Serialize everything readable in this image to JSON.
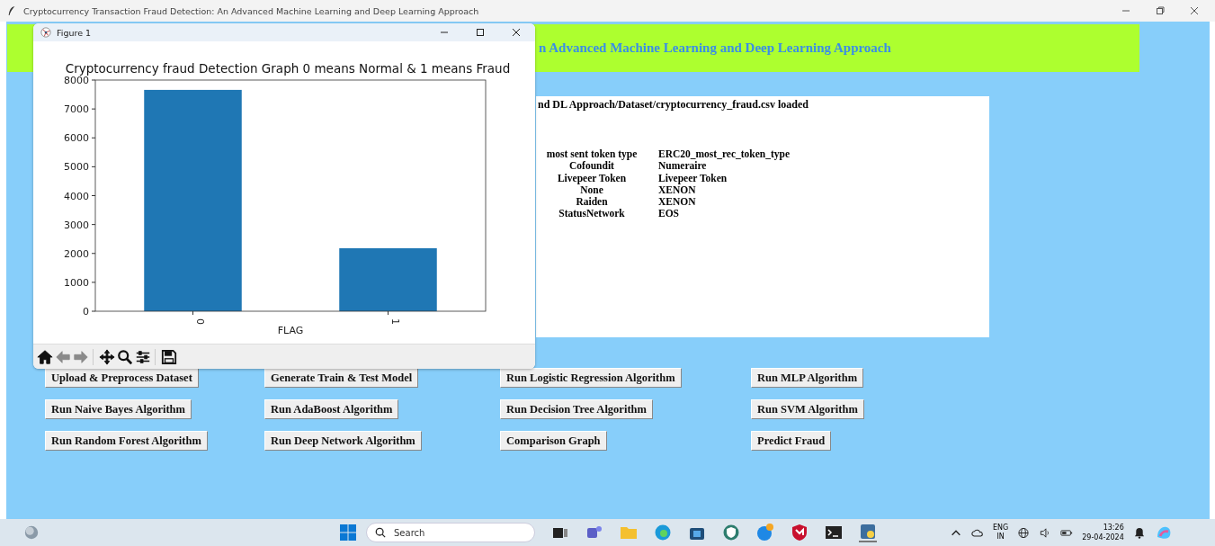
{
  "app": {
    "title": "Cryptocurrency Transaction Fraud Detection: An Advanced Machine Learning and Deep Learning Approach",
    "header": "n Advanced Machine Learning and Deep Learning Approach",
    "output": {
      "status_line": "nd DL Approach/Dataset/cryptocurrency_fraud.csv loaded",
      "table": {
        "columns": [
          "most sent token type",
          "ERC20_most_rec_token_type"
        ],
        "rows": [
          [
            "Cofoundit",
            "Numeraire"
          ],
          [
            "Livepeer Token",
            "Livepeer Token"
          ],
          [
            "None",
            "XENON"
          ],
          [
            "Raiden",
            "XENON"
          ],
          [
            "StatusNetwork",
            "EOS"
          ]
        ]
      }
    },
    "buttons": [
      "Upload & Preprocess Dataset",
      "Generate Train & Test Model",
      "Run Logistic Regression Algorithm",
      "Run MLP Algorithm",
      "Run Naive Bayes Algorithm",
      "Run AdaBoost Algorithm",
      "Run Decision Tree Algorithm",
      "Run SVM Algorithm",
      "Run Random Forest Algorithm",
      "Run Deep Network Algorithm",
      "Comparison Graph",
      "Predict Fraud"
    ]
  },
  "figure": {
    "title": "Figure 1",
    "chart_data": {
      "type": "bar",
      "title": "Cryptocurrency fraud Detection Graph 0 means Normal & 1 means Fraud",
      "xlabel": "FLAG",
      "categories": [
        "0",
        "1"
      ],
      "values": [
        7660,
        2180
      ],
      "ylim": [
        0,
        8000
      ],
      "yticks": [
        0,
        1000,
        2000,
        3000,
        4000,
        5000,
        6000,
        7000,
        8000
      ]
    },
    "toolbar": [
      {
        "kind": "home",
        "disabled": false
      },
      {
        "kind": "back",
        "disabled": true
      },
      {
        "kind": "forward",
        "disabled": true
      },
      {
        "kind": "pan",
        "disabled": false
      },
      {
        "kind": "zoom",
        "disabled": false
      },
      {
        "kind": "configure",
        "disabled": false
      },
      {
        "kind": "save",
        "disabled": false
      }
    ]
  },
  "taskbar": {
    "search": {
      "placeholder": "Search"
    },
    "language": [
      "ENG",
      "IN"
    ],
    "time": "13:26",
    "date": "29-04-2024"
  }
}
